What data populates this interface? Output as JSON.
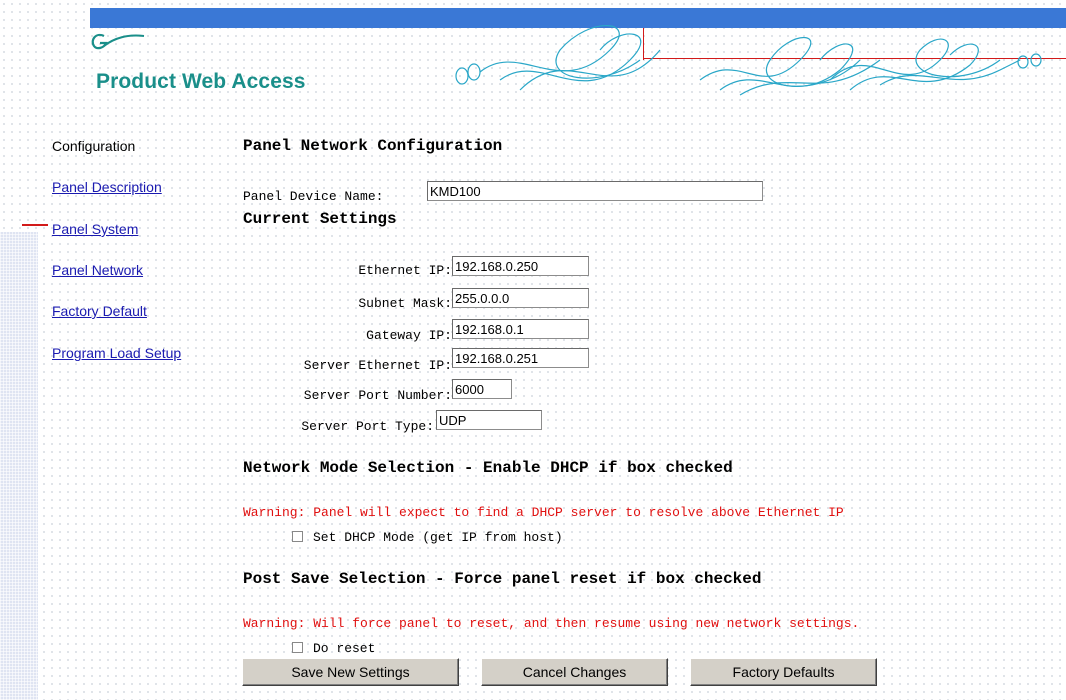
{
  "header": {
    "brand_title": "Product Web Access"
  },
  "nav": {
    "heading": "Configuration",
    "links": [
      "Panel Description",
      "Panel System",
      "Panel Network",
      "Factory Default",
      "Program Load Setup"
    ]
  },
  "main": {
    "title": "Panel Network Configuration",
    "device_name_label": "Panel Device Name:",
    "device_name_value": "KMD100",
    "current_settings_heading": "Current Settings",
    "fields": {
      "ethernet_ip": {
        "label": "Ethernet IP:",
        "value": "192.168.0.250"
      },
      "subnet_mask": {
        "label": "Subnet Mask:",
        "value": "255.0.0.0"
      },
      "gateway_ip": {
        "label": "Gateway IP:",
        "value": "192.168.0.1"
      },
      "server_ethernet_ip": {
        "label": "Server Ethernet IP:",
        "value": "192.168.0.251"
      },
      "server_port_number": {
        "label": "Server Port Number:",
        "value": "6000"
      },
      "server_port_type": {
        "label": "Server Port Type:",
        "value": "UDP"
      }
    },
    "network_mode": {
      "heading": "Network Mode Selection - Enable DHCP if box checked",
      "warning": "Warning: Panel will expect to find a DHCP server to resolve above Ethernet IP",
      "checkbox_label": "Set DHCP Mode (get IP from host)",
      "checked": false
    },
    "post_save": {
      "heading": "Post Save Selection - Force panel reset if box checked",
      "warning": "Warning: Will force panel to reset, and then resume using new network settings.",
      "checkbox_label": "Do reset",
      "checked": false
    },
    "buttons": {
      "save": "Save New Settings",
      "cancel": "Cancel Changes",
      "factory": "Factory Defaults"
    }
  },
  "colors": {
    "top_bar": "#3a78d6",
    "brand": "#1a8f8a",
    "link": "#1a1ab0",
    "warning": "#e01010",
    "swirl": "#2aa7c8",
    "accent_red": "#d21a1a"
  },
  "icons": [
    "grass-valley-logo-icon",
    "swirl-decoration-icon"
  ]
}
